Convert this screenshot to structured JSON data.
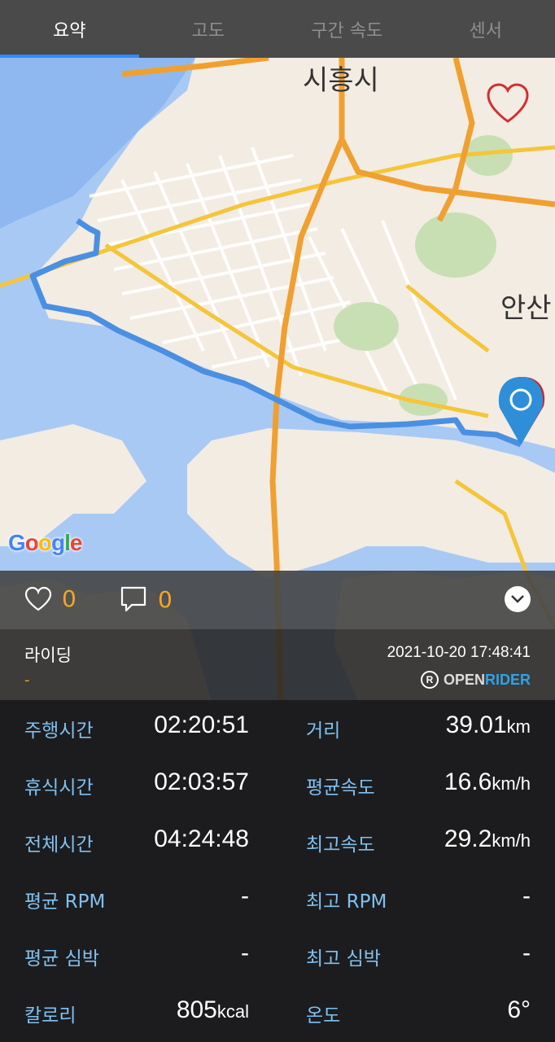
{
  "tabs": [
    {
      "label": "요약",
      "active": true
    },
    {
      "label": "고도",
      "active": false
    },
    {
      "label": "구간 속도",
      "active": false
    },
    {
      "label": "센서",
      "active": false
    }
  ],
  "map": {
    "city_labels": [
      "시흥시",
      "안산"
    ],
    "provider": "Google",
    "route_color": "#4a90e2"
  },
  "social": {
    "likes": "0",
    "comments": "0"
  },
  "activity": {
    "title": "라이딩",
    "description": "-",
    "datetime": "2021-10-20 17:48:41",
    "brand_open": "OPEN",
    "brand_rider": "RIDER"
  },
  "stats": [
    {
      "left": {
        "label": "주행시간",
        "value": "02:20:51",
        "unit": ""
      },
      "right": {
        "label": "거리",
        "value": "39.01",
        "unit": "km"
      }
    },
    {
      "left": {
        "label": "휴식시간",
        "value": "02:03:57",
        "unit": ""
      },
      "right": {
        "label": "평균속도",
        "value": "16.6",
        "unit": "km/h"
      }
    },
    {
      "left": {
        "label": "전체시간",
        "value": "04:24:48",
        "unit": ""
      },
      "right": {
        "label": "최고속도",
        "value": "29.2",
        "unit": "km/h"
      }
    },
    {
      "left": {
        "label": "평균 RPM",
        "value": "-",
        "unit": ""
      },
      "right": {
        "label": "최고 RPM",
        "value": "-",
        "unit": ""
      }
    },
    {
      "left": {
        "label": "평균 심박",
        "value": "-",
        "unit": ""
      },
      "right": {
        "label": "최고 심박",
        "value": "-",
        "unit": ""
      }
    },
    {
      "left": {
        "label": "칼로리",
        "value": "805",
        "unit": "kcal"
      },
      "right": {
        "label": "온도",
        "value": "6°",
        "unit": ""
      }
    }
  ],
  "colors": {
    "accent": "#2e8bff",
    "label": "#7fc1f2",
    "count": "#f5a623"
  }
}
